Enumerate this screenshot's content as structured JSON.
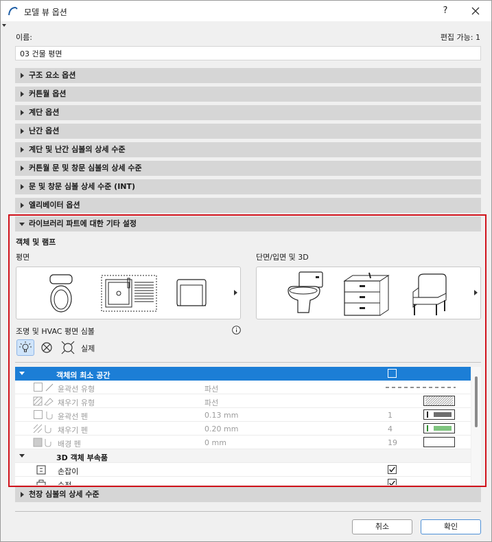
{
  "window": {
    "title": "모델 뷰 옵션",
    "help_label": "?"
  },
  "name_field": {
    "label": "이름:",
    "value": "03 건물 평면",
    "edit_status": "편집 가능: 1"
  },
  "sections_collapsed": [
    "구조 요소 옵션",
    "커튼월 옵션",
    "계단 옵션",
    "난간 옵션",
    "계단 및 난간 심볼의 상세 수준",
    "커튼월 문 및 창문 심볼의 상세 수준",
    "문 및 창문 심볼 상세 수준 (INT)",
    "엘리베이터 옵션"
  ],
  "library_section": {
    "title": "라이브러리 파트에 대한 기타 설정",
    "objects_lamps": "객체 및 램프",
    "plan_label": "평면",
    "section_label": "단면/입면 및 3D",
    "lighting_label": "조명 및 HVAC 평면 심볼",
    "real_label": "실제"
  },
  "tree": {
    "group1": "객체의 최소 공간",
    "rows": [
      {
        "name": "윤곽선 유형",
        "value": "파선",
        "num": ""
      },
      {
        "name": "채우기 유형",
        "value": "파선",
        "num": ""
      },
      {
        "name": "윤곽선 펜",
        "value": "0.13 mm",
        "num": "1"
      },
      {
        "name": "채우기 펜",
        "value": "0.20 mm",
        "num": "4"
      },
      {
        "name": "배경 펜",
        "value": "0 mm",
        "num": "19"
      }
    ],
    "group2": "3D 객체 부속품",
    "sub_rows": [
      {
        "name": "손잡이"
      },
      {
        "name": "수전"
      }
    ],
    "pen_colors": [
      "#6d6d6d",
      "#7ec47e"
    ]
  },
  "last_section": "천장 심볼의 상세 수준",
  "buttons": {
    "cancel": "취소",
    "ok": "확인"
  }
}
